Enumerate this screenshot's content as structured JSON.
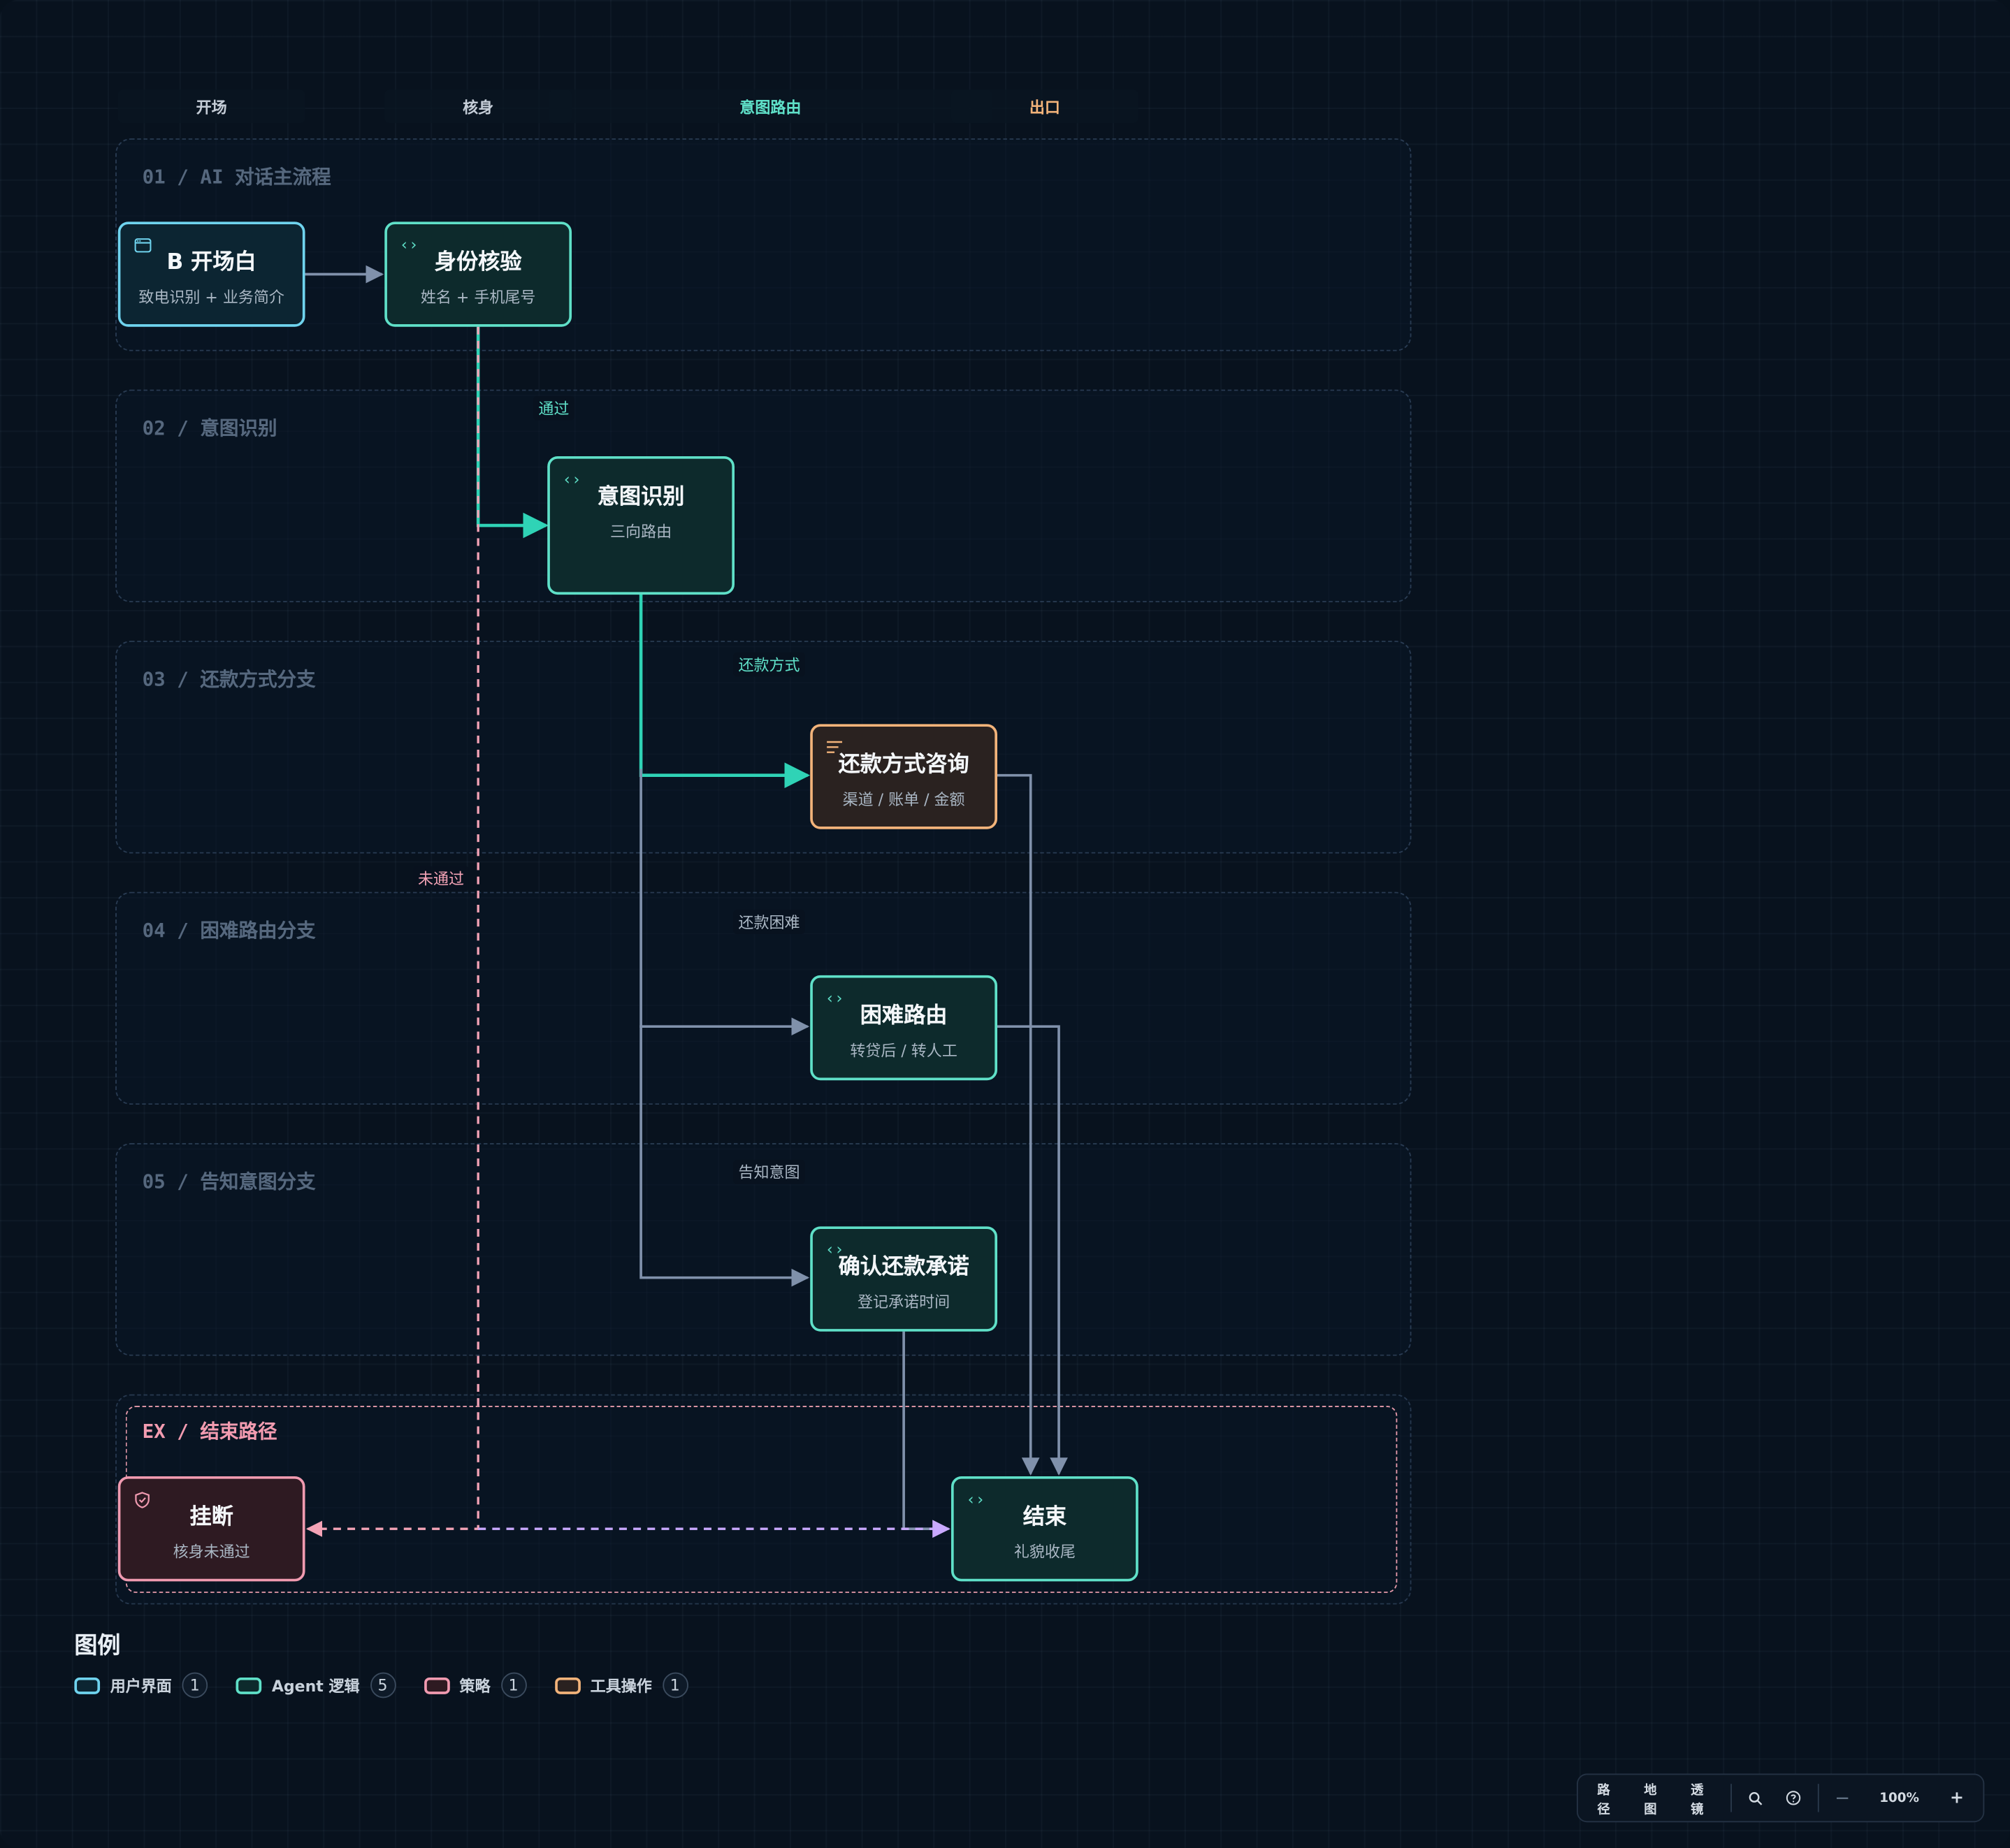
{
  "columns": [
    "开场",
    "核身",
    "意图路由",
    "出口"
  ],
  "column_colors": [
    "#c4ccd6",
    "#c4ccd6",
    "#5fe0c8",
    "#f2b37a"
  ],
  "lanes": [
    {
      "title": "01 / AI 对话主流程"
    },
    {
      "title": "02 / 意图识别"
    },
    {
      "title": "03 / 还款方式分支"
    },
    {
      "title": "04 / 困难路由分支"
    },
    {
      "title": "05 / 告知意图分支"
    },
    {
      "title": "EX / 结束路径"
    }
  ],
  "nodes": {
    "opening": {
      "title": "B 开场白",
      "sub": "致电识别 + 业务简介",
      "icon": "window-icon",
      "type": "ui"
    },
    "identity": {
      "title": "身份核验",
      "sub": "姓名 + 手机尾号",
      "icon": "code-icon",
      "type": "agent"
    },
    "intent": {
      "title": "意图识别",
      "sub": "三向路由",
      "icon": "code-icon",
      "type": "agent"
    },
    "repay_method": {
      "title": "还款方式咨询",
      "sub": "渠道 / 账单 / 金额",
      "icon": "list-icon",
      "type": "tool"
    },
    "hardship": {
      "title": "困难路由",
      "sub": "转贷后 / 转人工",
      "icon": "code-icon",
      "type": "agent"
    },
    "confirm": {
      "title": "确认还款承诺",
      "sub": "登记承诺时间",
      "icon": "code-icon",
      "type": "agent"
    },
    "hangup": {
      "title": "挂断",
      "sub": "核身未通过",
      "icon": "shield-icon",
      "type": "policy"
    },
    "end": {
      "title": "结束",
      "sub": "礼貌收尾",
      "icon": "code-icon",
      "type": "agent"
    }
  },
  "edge_labels": {
    "pass": "通过",
    "fail": "未通过",
    "repay_method": "还款方式",
    "hardship": "还款困难",
    "inform": "告知意图"
  },
  "legend": {
    "title": "图例",
    "items": [
      {
        "label": "用户界面",
        "count": "1",
        "color": "#6fd3ee"
      },
      {
        "label": "Agent 逻辑",
        "count": "5",
        "color": "#5fe0c8"
      },
      {
        "label": "策略",
        "count": "1",
        "color": "#f09ab0"
      },
      {
        "label": "工具操作",
        "count": "1",
        "color": "#f2b37a"
      }
    ]
  },
  "toolbar": {
    "path": "路径",
    "map": "地图",
    "lens": "透镜",
    "zoom_out": "—",
    "zoom": "100%",
    "zoom_in": "+"
  },
  "colors": {
    "accent": "#5fe0c8",
    "ui": "#6fd3ee",
    "tool": "#f2b37a",
    "policy": "#f09ab0",
    "edge": "#8091ab",
    "end_edge": "#c9a9ff"
  }
}
